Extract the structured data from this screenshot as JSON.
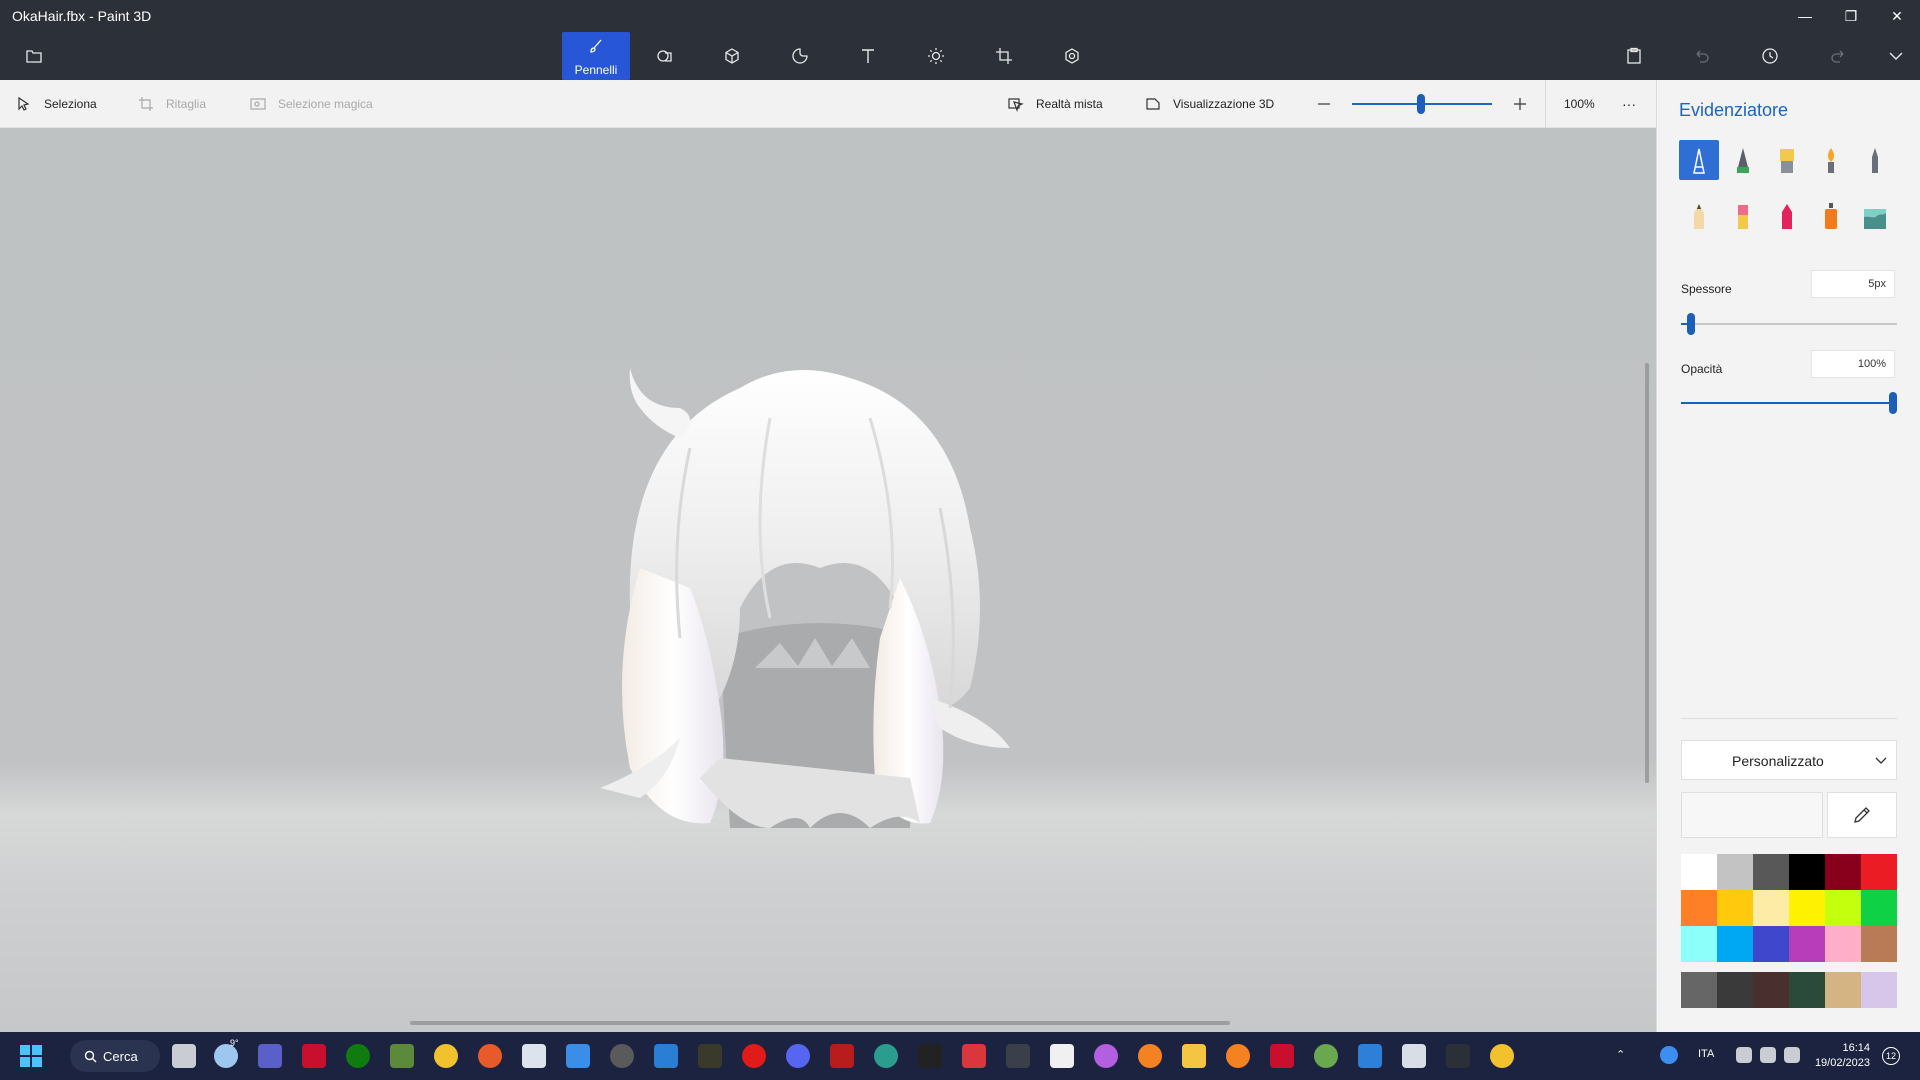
{
  "window": {
    "title": "OkaHair.fbx - Paint 3D"
  },
  "commandbar": {
    "active_tool_label": "Pennelli",
    "tools": [
      "brushes",
      "2d-shapes",
      "3d-shapes",
      "stickers",
      "text",
      "effects",
      "canvas",
      "3d-library"
    ]
  },
  "subbar": {
    "select": "Seleziona",
    "crop": "Ritaglia",
    "magic_select": "Selezione magica",
    "mixed_reality": "Realtà mista",
    "view_3d": "Visualizzazione 3D",
    "zoom": "100%",
    "zoom_level": 0.5,
    "more": "···"
  },
  "panel": {
    "title": "Evidenziatore",
    "brushes": [
      "marker",
      "calligraphy-pen",
      "oil-brush",
      "watercolor",
      "pixel-pen",
      "pencil",
      "eraser",
      "crayon",
      "spray-can",
      "fill"
    ],
    "thickness_label": "Spessore",
    "thickness_value": "5px",
    "thickness_level": 0.05,
    "opacity_label": "Opacità",
    "opacity_value": "100%",
    "opacity_level": 1.0,
    "color_mode": "Personalizzato",
    "palette": [
      "#ffffff",
      "#c3c3c3",
      "#585858",
      "#000000",
      "#88001b",
      "#ec1c24",
      "#ff7f27",
      "#ffc90e",
      "#fdeca6",
      "#fff200",
      "#c4ff0e",
      "#0ed145",
      "#8cfffb",
      "#00a8f3",
      "#3f48cc",
      "#b83dba",
      "#ffaec8",
      "#b97a56"
    ],
    "custom_palette": [
      "#666666",
      "#3a3a3a",
      "#4a2f2f",
      "#2a4a3a",
      "#d4b483",
      "#d8c6ea"
    ]
  },
  "taskbar": {
    "search": "Cerca",
    "weather": "9°",
    "language": "ITA",
    "time": "16:14",
    "date": "19/02/2023",
    "notifications": "12"
  }
}
